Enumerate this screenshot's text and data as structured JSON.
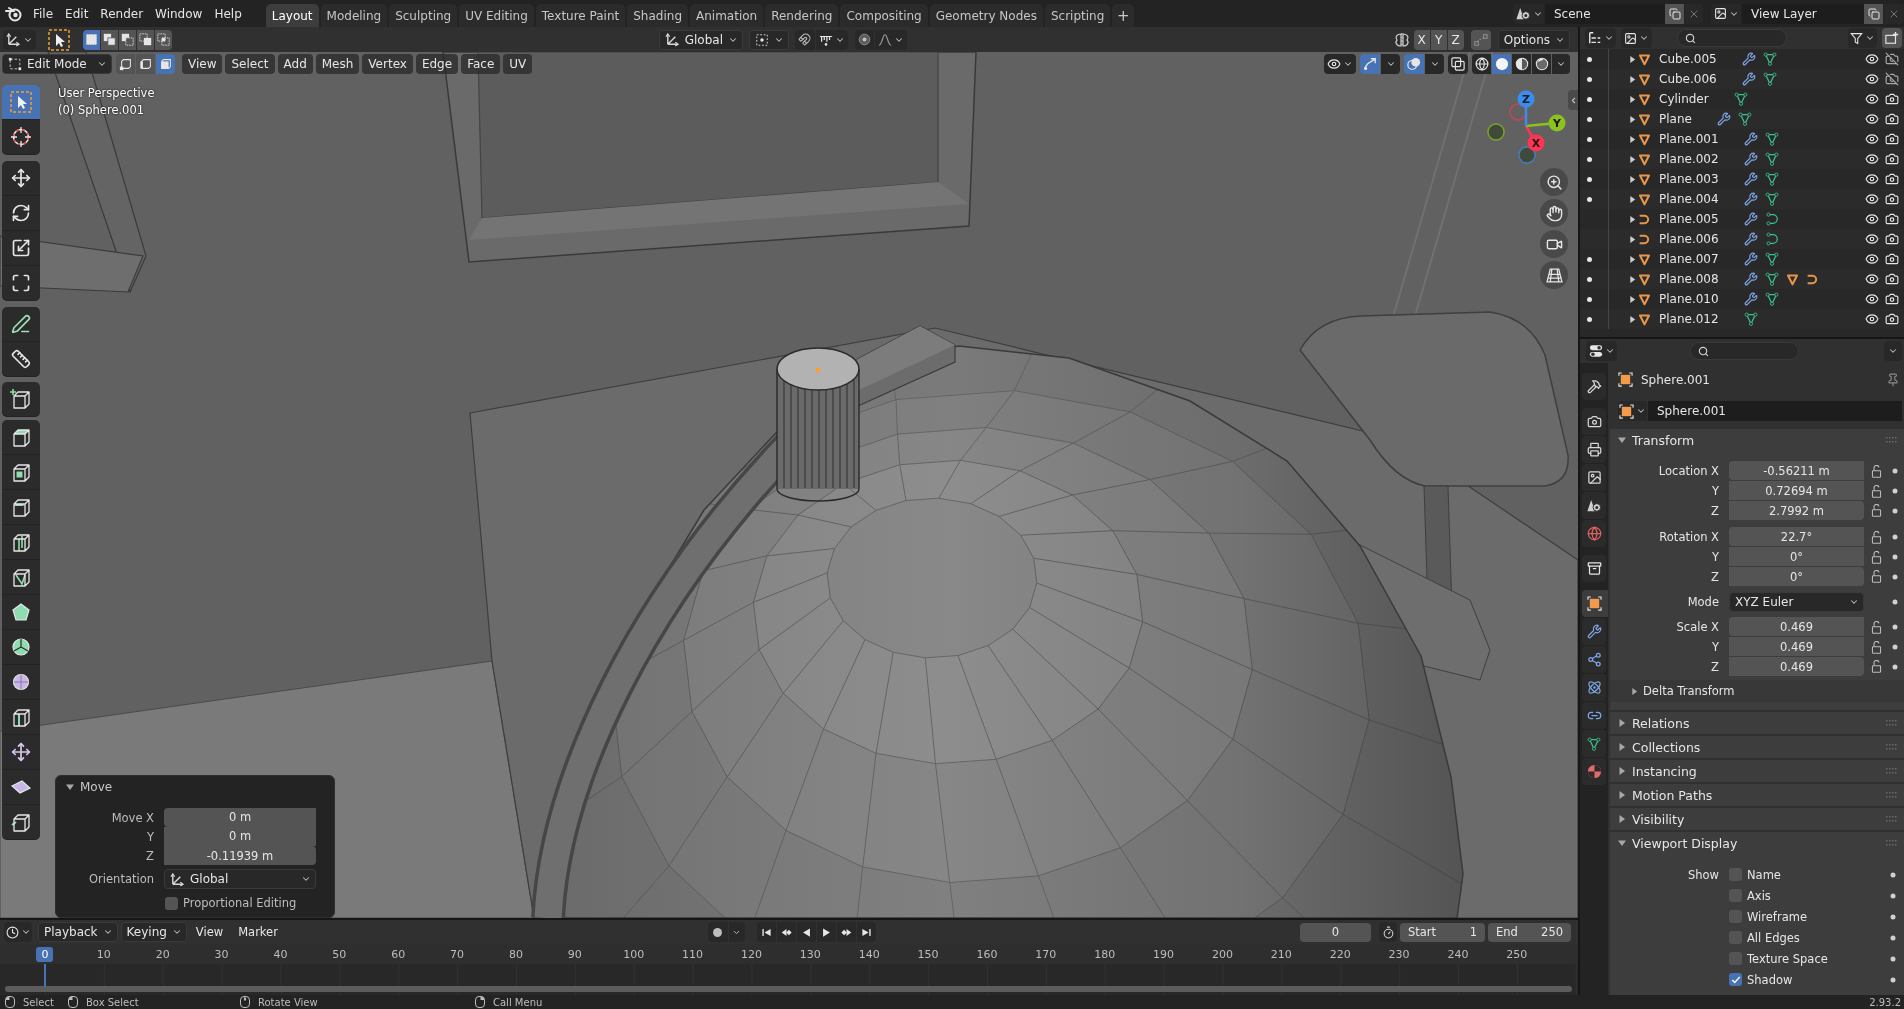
{
  "top_bar": {
    "menus": [
      "File",
      "Edit",
      "Render",
      "Window",
      "Help"
    ],
    "workspaces": [
      {
        "label": "Layout",
        "selected": true
      },
      {
        "label": "Modeling",
        "selected": false
      },
      {
        "label": "Sculpting",
        "selected": false
      },
      {
        "label": "UV Editing",
        "selected": false
      },
      {
        "label": "Texture Paint",
        "selected": false
      },
      {
        "label": "Shading",
        "selected": false
      },
      {
        "label": "Animation",
        "selected": false
      },
      {
        "label": "Rendering",
        "selected": false
      },
      {
        "label": "Compositing",
        "selected": false
      },
      {
        "label": "Geometry Nodes",
        "selected": false
      },
      {
        "label": "Scripting",
        "selected": false
      }
    ],
    "add_workspace": "+",
    "scene": "Scene",
    "view_layer": "View Layer"
  },
  "tool_settings": {
    "select_modes": [
      {
        "kind": "set",
        "selected": true
      },
      {
        "kind": "extend",
        "selected": false
      },
      {
        "kind": "subtract",
        "selected": false
      },
      {
        "kind": "invert",
        "selected": false
      },
      {
        "kind": "intersect",
        "selected": false
      }
    ],
    "orientation": "Global",
    "snap": false,
    "proportional_editing": false,
    "mirror_axes": [
      {
        "label": "X",
        "selected": false
      },
      {
        "label": "Y",
        "selected": false
      },
      {
        "label": "Z",
        "selected": false
      }
    ],
    "auto_merge": false,
    "options": "Options"
  },
  "viewport_header": {
    "mode": "Edit Mode",
    "select_modes": [
      {
        "kind": "vertex",
        "selected": false
      },
      {
        "kind": "edge",
        "selected": false
      },
      {
        "kind": "face",
        "selected": true
      }
    ],
    "menus": [
      "View",
      "Select",
      "Add",
      "Mesh",
      "Vertex",
      "Edge",
      "Face",
      "UV"
    ],
    "gizmos": true,
    "overlays": true,
    "xray": false,
    "shading": [
      {
        "kind": "wireframe",
        "selected": false
      },
      {
        "kind": "solid",
        "selected": true
      },
      {
        "kind": "material",
        "selected": false
      },
      {
        "kind": "rendered",
        "selected": false
      }
    ]
  },
  "viewport": {
    "view_name": "User Perspective",
    "object_info": "(0) Sphere.001",
    "axes": [
      {
        "label": "X",
        "color": "#ff3352"
      },
      {
        "label": "Y",
        "color": "#8bc21f"
      },
      {
        "label": "Z",
        "color": "#3a8df0"
      }
    ],
    "navigation": [
      {
        "kind": "zoom"
      },
      {
        "kind": "pan"
      },
      {
        "kind": "camera"
      },
      {
        "kind": "ortho"
      }
    ]
  },
  "toolbar": {
    "groups": [
      [
        {
          "kind": "select_box",
          "selected": true
        },
        {
          "kind": "cursor",
          "selected": false
        }
      ],
      [
        {
          "kind": "move",
          "selected": false
        },
        {
          "kind": "rotate",
          "selected": false
        },
        {
          "kind": "scale",
          "selected": false
        },
        {
          "kind": "transform",
          "selected": false
        }
      ],
      [
        {
          "kind": "annotate",
          "selected": false
        },
        {
          "kind": "measure",
          "selected": false
        }
      ],
      [
        {
          "kind": "add_cube",
          "selected": false
        }
      ],
      [
        {
          "kind": "extrude",
          "selected": false
        },
        {
          "kind": "inset",
          "selected": false
        },
        {
          "kind": "bevel",
          "selected": false
        },
        {
          "kind": "loop_cut",
          "selected": false
        },
        {
          "kind": "knife",
          "selected": false
        },
        {
          "kind": "poly_build",
          "selected": false
        },
        {
          "kind": "spin",
          "selected": false
        },
        {
          "kind": "smooth",
          "selected": false
        },
        {
          "kind": "edge_slide",
          "selected": false
        },
        {
          "kind": "shrink_fatten",
          "selected": false
        },
        {
          "kind": "shear",
          "selected": false
        },
        {
          "kind": "rip",
          "selected": false
        }
      ]
    ]
  },
  "move_panel": {
    "title": "Move",
    "expanded": true,
    "fields": [
      {
        "label": "Move X",
        "value": "0 m"
      },
      {
        "label": "Y",
        "value": "0 m"
      },
      {
        "label": "Z",
        "value": "-0.11939 m"
      }
    ],
    "orientation": {
      "label": "Orientation",
      "value": "Global"
    },
    "proportional": {
      "label": "Proportional Editing",
      "checked": false
    }
  },
  "timeline": {
    "menus": [
      {
        "label": "Playback",
        "dropdown": true
      },
      {
        "label": "Keying",
        "dropdown": true
      },
      {
        "label": "View",
        "dropdown": false
      },
      {
        "label": "Marker",
        "dropdown": false
      }
    ],
    "auto_keying": false,
    "transport": [
      {
        "kind": "jump_start"
      },
      {
        "kind": "prev_key"
      },
      {
        "kind": "play_reverse"
      },
      {
        "kind": "play"
      },
      {
        "kind": "next_key"
      },
      {
        "kind": "jump_end"
      }
    ],
    "current_frame": "0",
    "preview_range": false,
    "start": {
      "label": "Start",
      "value": "1"
    },
    "end": {
      "label": "End",
      "value": "250"
    },
    "ruler": [
      {
        "label": "0",
        "current": true
      },
      {
        "label": "10",
        "current": false
      },
      {
        "label": "20",
        "current": false
      },
      {
        "label": "30",
        "current": false
      },
      {
        "label": "40",
        "current": false
      },
      {
        "label": "50",
        "current": false
      },
      {
        "label": "60",
        "current": false
      },
      {
        "label": "70",
        "current": false
      },
      {
        "label": "80",
        "current": false
      },
      {
        "label": "90",
        "current": false
      },
      {
        "label": "100",
        "current": false
      },
      {
        "label": "110",
        "current": false
      },
      {
        "label": "120",
        "current": false
      },
      {
        "label": "130",
        "current": false
      },
      {
        "label": "140",
        "current": false
      },
      {
        "label": "150",
        "current": false
      },
      {
        "label": "160",
        "current": false
      },
      {
        "label": "170",
        "current": false
      },
      {
        "label": "180",
        "current": false
      },
      {
        "label": "190",
        "current": false
      },
      {
        "label": "200",
        "current": false
      },
      {
        "label": "210",
        "current": false
      },
      {
        "label": "220",
        "current": false
      },
      {
        "label": "230",
        "current": false
      },
      {
        "label": "240",
        "current": false
      },
      {
        "label": "250",
        "current": false
      }
    ]
  },
  "outliner": {
    "rows": [
      {
        "name": "Cube.005",
        "kind": "mesh",
        "edit_toggle": true,
        "expanded": false,
        "content": [
          {
            "kind": "modifier"
          },
          {
            "kind": "mesh_data"
          }
        ],
        "visible": true,
        "renderable": false
      },
      {
        "name": "Cube.006",
        "kind": "mesh",
        "edit_toggle": true,
        "expanded": false,
        "content": [
          {
            "kind": "modifier"
          },
          {
            "kind": "mesh_data"
          }
        ],
        "visible": true,
        "renderable": false
      },
      {
        "name": "Cylinder",
        "kind": "mesh",
        "edit_toggle": true,
        "expanded": false,
        "content": [
          {
            "kind": "mesh_data"
          }
        ],
        "visible": true,
        "renderable": true
      },
      {
        "name": "Plane",
        "kind": "mesh",
        "edit_toggle": true,
        "expanded": false,
        "content": [
          {
            "kind": "modifier"
          },
          {
            "kind": "mesh_data"
          }
        ],
        "visible": true,
        "renderable": true
      },
      {
        "name": "Plane.001",
        "kind": "mesh",
        "edit_toggle": true,
        "expanded": false,
        "content": [
          {
            "kind": "modifier"
          },
          {
            "kind": "mesh_data"
          }
        ],
        "visible": true,
        "renderable": true
      },
      {
        "name": "Plane.002",
        "kind": "mesh",
        "edit_toggle": true,
        "expanded": false,
        "content": [
          {
            "kind": "modifier"
          },
          {
            "kind": "mesh_data"
          }
        ],
        "visible": true,
        "renderable": true
      },
      {
        "name": "Plane.003",
        "kind": "mesh",
        "edit_toggle": true,
        "expanded": false,
        "content": [
          {
            "kind": "modifier"
          },
          {
            "kind": "mesh_data"
          }
        ],
        "visible": true,
        "renderable": true
      },
      {
        "name": "Plane.004",
        "kind": "mesh",
        "edit_toggle": true,
        "expanded": false,
        "content": [
          {
            "kind": "modifier"
          },
          {
            "kind": "mesh_data"
          }
        ],
        "visible": true,
        "renderable": true
      },
      {
        "name": "Plane.005",
        "kind": "curve",
        "edit_toggle": false,
        "expanded": false,
        "content": [
          {
            "kind": "modifier"
          },
          {
            "kind": "curve_data"
          }
        ],
        "visible": true,
        "renderable": true
      },
      {
        "name": "Plane.006",
        "kind": "curve",
        "edit_toggle": false,
        "expanded": false,
        "content": [
          {
            "kind": "modifier"
          },
          {
            "kind": "curve_data"
          }
        ],
        "visible": true,
        "renderable": true
      },
      {
        "name": "Plane.007",
        "kind": "mesh",
        "edit_toggle": true,
        "expanded": false,
        "content": [
          {
            "kind": "modifier"
          },
          {
            "kind": "mesh_data"
          }
        ],
        "visible": true,
        "renderable": true
      },
      {
        "name": "Plane.008",
        "kind": "mesh",
        "edit_toggle": true,
        "expanded": false,
        "content": [
          {
            "kind": "modifier"
          },
          {
            "kind": "mesh_data"
          },
          {
            "kind": "mesh"
          },
          {
            "kind": "curve"
          }
        ],
        "visible": true,
        "renderable": true
      },
      {
        "name": "Plane.010",
        "kind": "mesh",
        "edit_toggle": true,
        "expanded": false,
        "content": [
          {
            "kind": "modifier"
          },
          {
            "kind": "mesh_data"
          }
        ],
        "visible": true,
        "renderable": true
      },
      {
        "name": "Plane.012",
        "kind": "mesh",
        "edit_toggle": true,
        "expanded": false,
        "content": [
          {
            "kind": "mesh_data"
          }
        ],
        "visible": true,
        "renderable": true
      }
    ]
  },
  "properties": {
    "tab_groups": [
      [
        {
          "kind": "tool",
          "selected": false
        }
      ],
      [
        {
          "kind": "render",
          "selected": false
        },
        {
          "kind": "output",
          "selected": false
        },
        {
          "kind": "view_layer",
          "selected": false
        },
        {
          "kind": "scene",
          "selected": false
        },
        {
          "kind": "world",
          "selected": false
        }
      ],
      [
        {
          "kind": "collection",
          "selected": false
        }
      ],
      [
        {
          "kind": "object",
          "selected": true
        },
        {
          "kind": "modifiers",
          "selected": false
        },
        {
          "kind": "particles",
          "selected": false
        },
        {
          "kind": "physics",
          "selected": false
        },
        {
          "kind": "constraints",
          "selected": false
        },
        {
          "kind": "data",
          "selected": false
        },
        {
          "kind": "material",
          "selected": false
        }
      ]
    ],
    "object_name": "Sphere.001",
    "datablock": "Sphere.001",
    "panels": [
      {
        "title": "Transform",
        "expanded": true,
        "groups": [
          {
            "kind": "vector",
            "rows": [
              {
                "label": "Location X",
                "value": "-0.56211 m",
                "locked": false
              },
              {
                "label": "Y",
                "value": "0.72694 m",
                "locked": false
              },
              {
                "label": "Z",
                "value": "2.7992 m",
                "locked": false
              }
            ]
          },
          {
            "kind": "vector",
            "rows": [
              {
                "label": "Rotation X",
                "value": "22.7°",
                "locked": false
              },
              {
                "label": "Y",
                "value": "0°",
                "locked": false
              },
              {
                "label": "Z",
                "value": "0°",
                "locked": false
              }
            ]
          },
          {
            "kind": "dropdown",
            "label": "Mode",
            "value": "XYZ Euler"
          },
          {
            "kind": "vector",
            "rows": [
              {
                "label": "Scale X",
                "value": "0.469",
                "locked": false
              },
              {
                "label": "Y",
                "value": "0.469",
                "locked": false
              },
              {
                "label": "Z",
                "value": "0.469",
                "locked": false
              }
            ]
          }
        ],
        "subpanels": [
          {
            "title": "Delta Transform",
            "expanded": false
          }
        ]
      },
      {
        "title": "Relations",
        "expanded": false
      },
      {
        "title": "Collections",
        "expanded": false
      },
      {
        "title": "Instancing",
        "expanded": false
      },
      {
        "title": "Motion Paths",
        "expanded": false
      },
      {
        "title": "Visibility",
        "expanded": false
      },
      {
        "title": "Viewport Display",
        "expanded": true,
        "show": {
          "label": "Show",
          "options": [
            {
              "label": "Name",
              "checked": false
            },
            {
              "label": "Axis",
              "checked": false
            },
            {
              "label": "Wireframe",
              "checked": false
            },
            {
              "label": "All Edges",
              "checked": false
            },
            {
              "label": "Texture Space",
              "checked": false
            },
            {
              "label": "Shadow",
              "checked": true
            }
          ]
        }
      }
    ]
  },
  "status_bar": {
    "hints": [
      {
        "kind": "left_click",
        "label": "Select"
      },
      {
        "kind": "left_drag",
        "label": "Box Select"
      },
      {
        "kind": "middle_drag",
        "label": "Rotate View"
      },
      {
        "kind": "right_click",
        "label": "Call Menu"
      }
    ],
    "version": "2.93.2"
  }
}
